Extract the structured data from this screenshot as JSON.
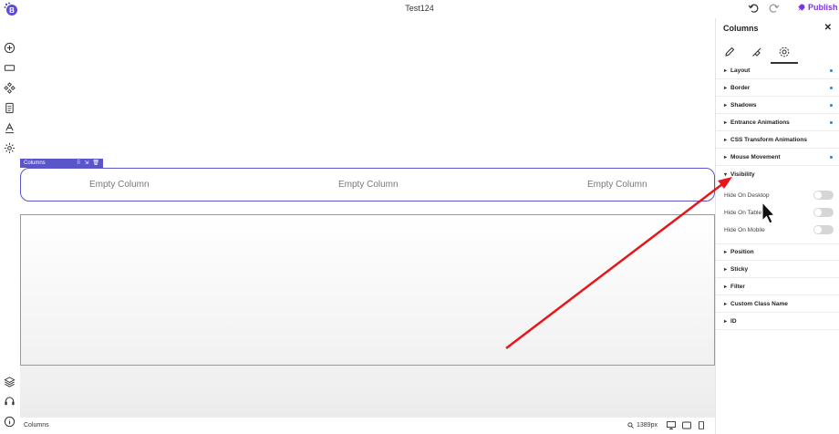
{
  "header": {
    "title": "Test124",
    "publish_label": "Publish"
  },
  "canvas": {
    "selected_tag": "Columns",
    "columns": [
      "Empty Column",
      "Empty Column",
      "Empty Column"
    ]
  },
  "footer": {
    "breadcrumb": "Columns",
    "zoom": "1389px"
  },
  "panel": {
    "title": "Columns",
    "tabs": [
      "edit-icon",
      "style-icon",
      "settings-icon"
    ],
    "active_tab": "settings-icon",
    "sections": [
      {
        "label": "Layout",
        "modified": true
      },
      {
        "label": "Border",
        "modified": true
      },
      {
        "label": "Shadows",
        "modified": true
      },
      {
        "label": "Entrance Animations",
        "modified": true
      },
      {
        "label": "CSS Transform Animations",
        "modified": false
      },
      {
        "label": "Mouse Movement",
        "modified": true
      },
      {
        "label": "Visibility",
        "open": true
      },
      {
        "label": "Position"
      },
      {
        "label": "Sticky"
      },
      {
        "label": "Filter"
      },
      {
        "label": "Custom Class Name"
      },
      {
        "label": "ID"
      }
    ],
    "visibility_options": [
      {
        "label": "Hide On Desktop",
        "enabled": false
      },
      {
        "label": "Hide On Tablet",
        "enabled": false
      },
      {
        "label": "Hide On Mobile",
        "enabled": false
      }
    ]
  },
  "colors": {
    "accent": "#5a55c8",
    "publish": "#7b35d8",
    "annotation_arrow": "#e8151b",
    "modified_dot": "#3b7bd9"
  }
}
